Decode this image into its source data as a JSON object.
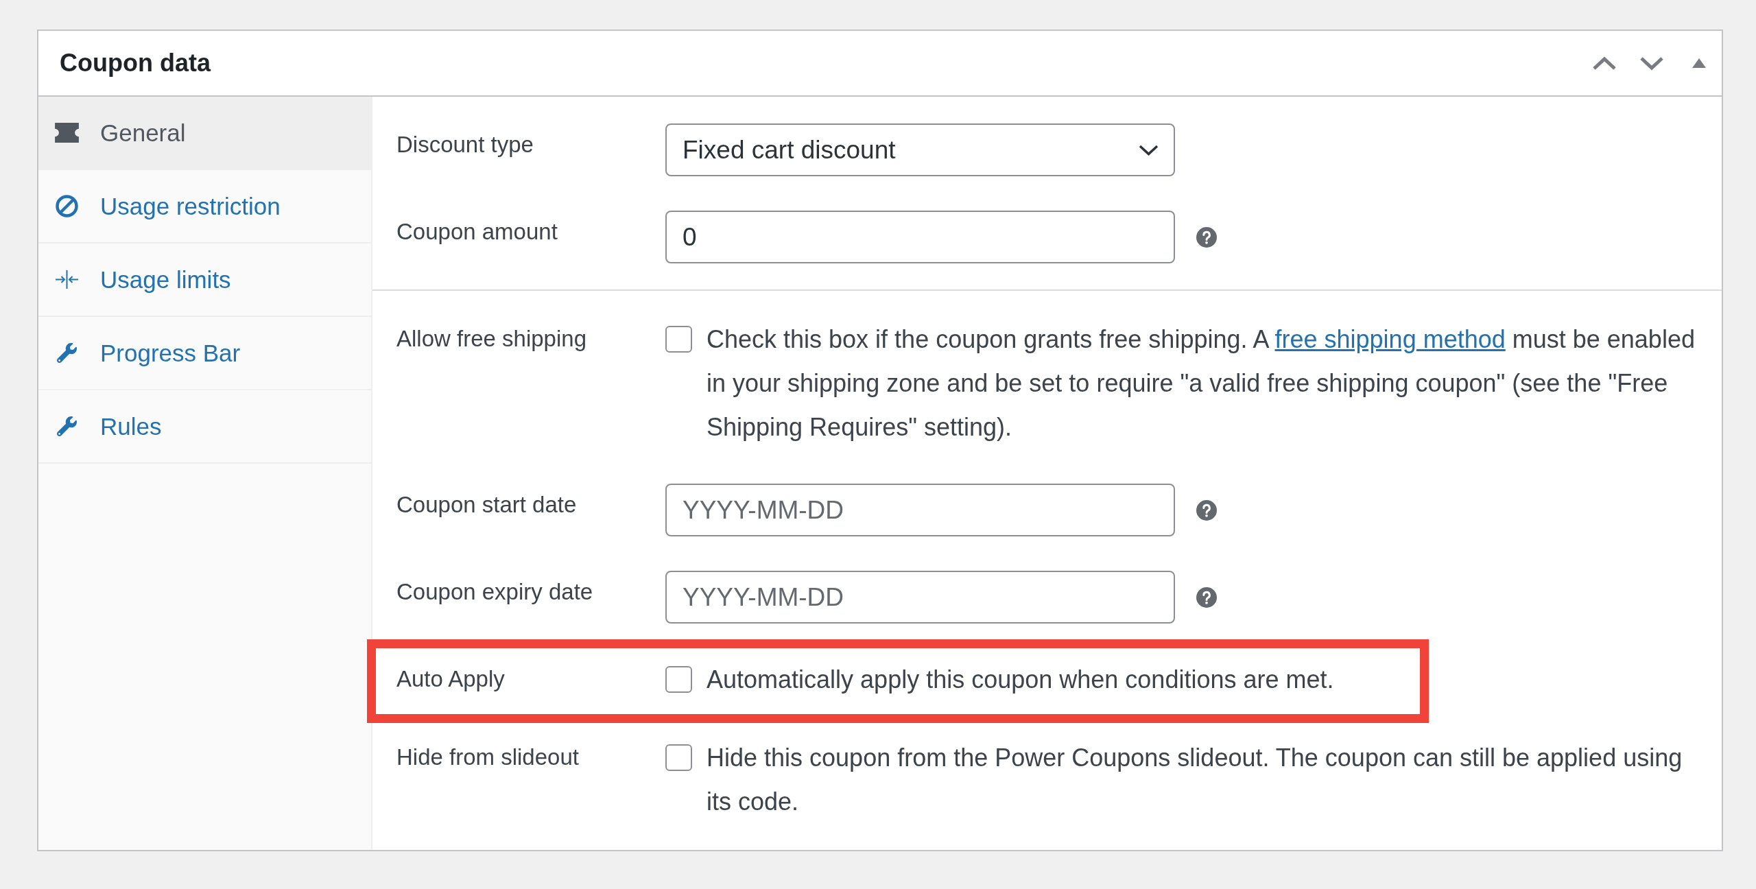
{
  "panel": {
    "title": "Coupon data",
    "expanded": true
  },
  "tabs": [
    {
      "label": "General",
      "selected": true
    },
    {
      "label": "Usage restriction",
      "selected": false
    },
    {
      "label": "Usage limits",
      "selected": false
    },
    {
      "label": "Progress Bar",
      "selected": false
    },
    {
      "label": "Rules",
      "selected": false
    }
  ],
  "sections": [
    {
      "fields": [
        {
          "kind": "select",
          "label": "Discount type",
          "value": "Fixed cart discount",
          "help": false,
          "highlighted": false
        },
        {
          "kind": "text",
          "label": "Coupon amount",
          "value": "0",
          "help": true,
          "highlighted": false
        }
      ]
    },
    {
      "fields": [
        {
          "kind": "checkbox",
          "label": "Allow free shipping",
          "checked": false,
          "description": "Check this box if the coupon grants free shipping. A ",
          "link": "free shipping method",
          "description_end": " must be enabled in your shipping zone and be set to require \"a valid free shipping coupon\" (see the \"Free Shipping Requires\" setting).",
          "highlighted": false
        },
        {
          "kind": "text",
          "label": "Coupon start date",
          "placeholder": "YYYY-MM-DD",
          "help": true,
          "highlighted": false
        },
        {
          "kind": "text",
          "label": "Coupon expiry date",
          "placeholder": "YYYY-MM-DD",
          "help": true,
          "highlighted": false
        },
        {
          "kind": "checkbox",
          "label": "Auto Apply",
          "checked": false,
          "description": "Automatically apply this coupon when conditions are met.",
          "highlighted": true
        },
        {
          "kind": "checkbox",
          "label": "Hide from slideout",
          "checked": false,
          "description": "Hide this coupon from the Power Coupons slideout. The coupon can still be applied using its code.",
          "highlighted": false
        }
      ]
    }
  ]
}
